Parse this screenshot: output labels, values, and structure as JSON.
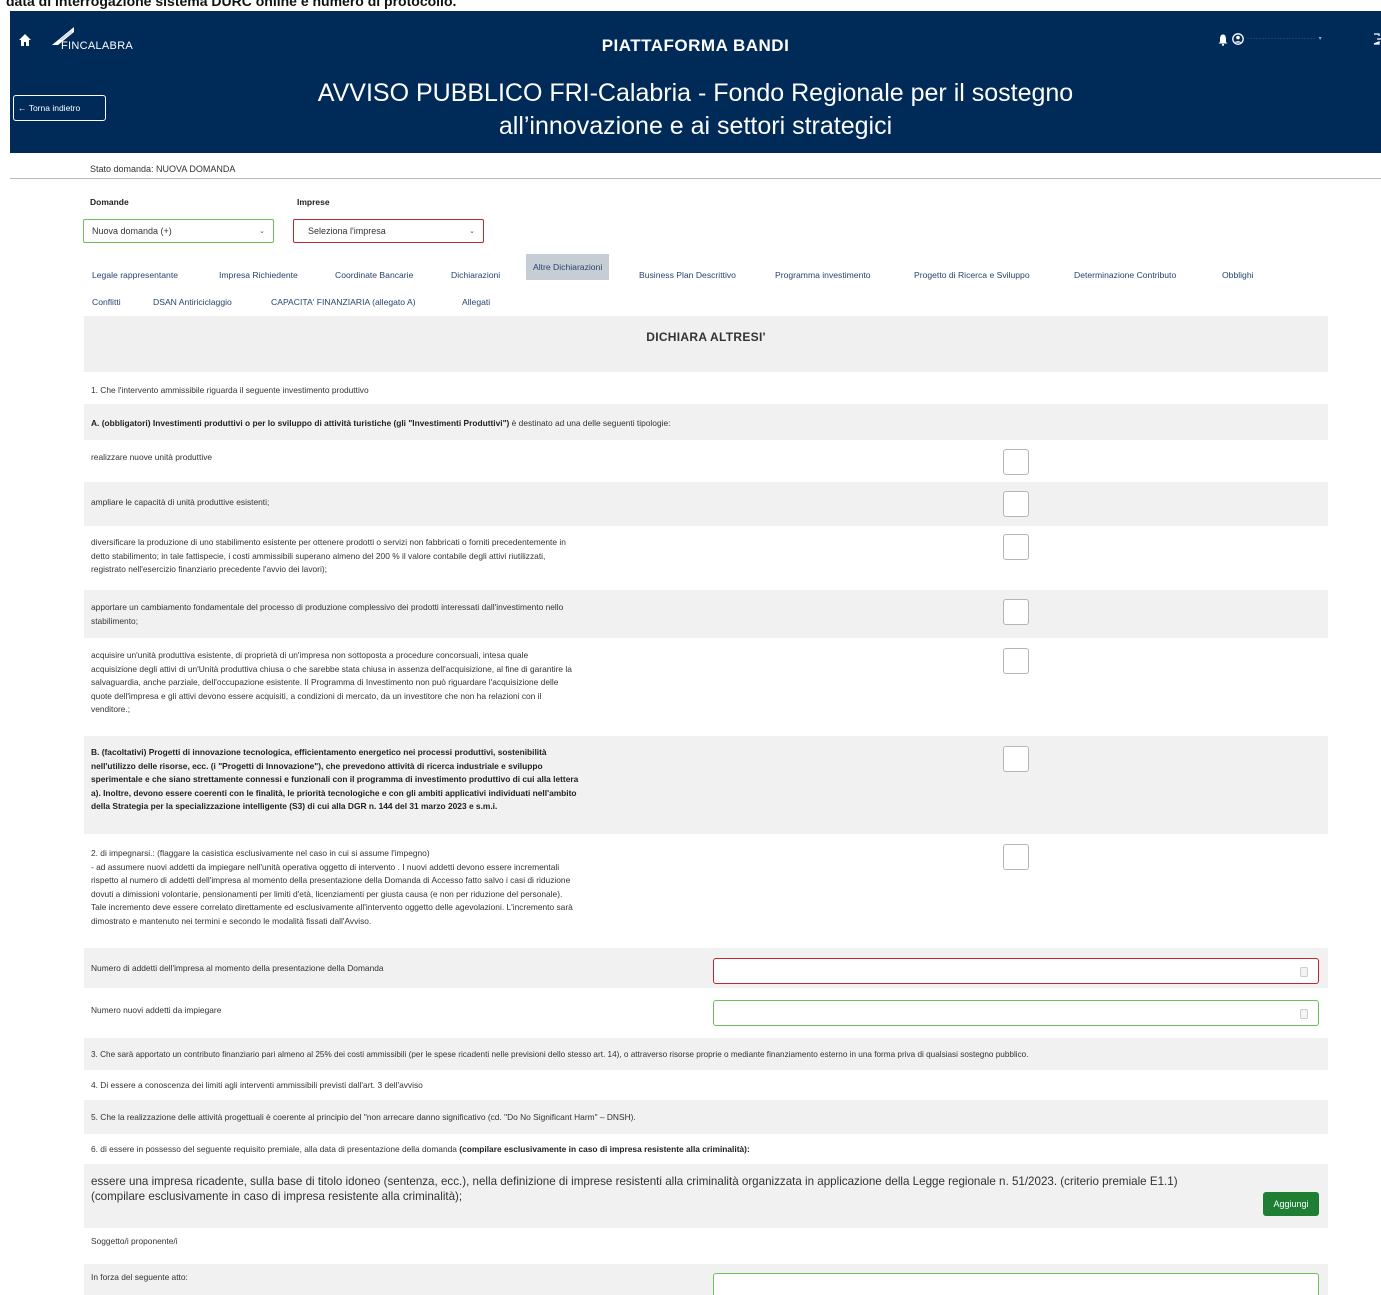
{
  "top_strip": "data di interrogazione sistema DURC online e numero di protocollo.",
  "header": {
    "logo_text": "FINCALABRA",
    "platform_title": "PIATTAFORMA BANDI",
    "title_line1": "AVVISO PUBBLICO FRI-Calabria - Fondo Regionale per il sostegno",
    "title_line2": "all’innovazione e ai settori strategici",
    "back_label": "← Torna indietro",
    "user_name": "······················· ▾"
  },
  "status": {
    "text": "Stato domanda: NUOVA DOMANDA"
  },
  "selects": {
    "domande_label": "Domande",
    "domande_value": "Nuova domanda (+)",
    "imprese_label": "Imprese",
    "imprese_value": "Seleziona l'impresa"
  },
  "tabs_row1": [
    "Legale rappresentante",
    "Impresa Richiedente",
    "Coordinate Bancarie",
    "Dichiarazioni",
    "Altre Dichiarazioni",
    "Business Plan Descrittivo",
    "Programma investimento",
    "Progetto di Ricerca e Sviluppo",
    "Determinazione Contributo",
    "Obblighi"
  ],
  "tabs_row2": [
    "Conflitti",
    "DSAN Antiriciclaggio",
    "CAPACITA' FINANZIARIA (allegato A)",
    "Allegati"
  ],
  "active_tab": "Altre Dichiarazioni",
  "section_title": "DICHIARA ALTRESI'",
  "items": {
    "intro": "1. Che l'intervento ammissibile riguarda il seguente investimento produttivo",
    "a_header_bold": "A. (obbligatori) Investimenti produttivi o per lo sviluppo di attività turistiche (gli \"Investimenti Produttivi\")",
    "a_header_rest": " è destinato ad una delle seguenti tipologie:",
    "a1": "realizzare nuove unità produttive",
    "a2": "ampliare le capacità di unità produttive esistenti;",
    "a3_l1": "diversificare la produzione di uno stabilimento esistente per ottenere prodotti o servizi non fabbricati o forniti precedentemente in",
    "a3_l2": "detto stabilimento; in tale fattispecie, i costi ammissibili superano almeno del 200 % il valore contabile degli attivi riutilizzati,",
    "a3_l3": "registrato nell'esercizio finanziario precedente l'avvio dei lavori);",
    "a4_l1": "apportare un cambiamento fondamentale del processo di produzione complessivo dei prodotti interessati dall'investimento nello",
    "a4_l2": "stabilimento;",
    "a5_l1": "acquisire un'unità produttiva esistente, di proprietà di un'impresa non sottoposta a procedure concorsuali, intesa quale",
    "a5_l2": "acquisizione degli attivi di un'Unità produttiva chiusa o che sarebbe stata chiusa in assenza dell'acquisizione, al fine di garantire la",
    "a5_l3": "salvaguardia, anche parziale, dell'occupazione esistente. Il Programma di Investimento non può riguardare l'acquisizione delle",
    "a5_l4": "quote dell'impresa e gli attivi devono essere acquisiti, a condizioni di mercato, da un investitore che non ha relazioni con il",
    "a5_l5": "venditore.;",
    "b_l1": "B. (facoltativi) Progetti di innovazione tecnologica, efficientamento energetico nei processi produttivi, sostenibilità",
    "b_l2": "nell'utilizzo delle risorse, ecc. (i \"Progetti di Innovazione\"), che prevedono attività di ricerca industriale e sviluppo",
    "b_l3": "sperimentale e che siano strettamente connessi e funzionali con il programma di investimento produttivo di cui alla lettera",
    "b_l4": "a). Inoltre, devono essere coerenti con le finalità, le priorità tecnologiche e con gli ambiti applicativi individuati nell'ambito",
    "b_l5": "della Strategia per la specializzazione intelligente (S3) di cui alla DGR n. 144 del 31 marzo 2023 e s.m.i.",
    "c2_l1": "2. di impegnarsi.: (flaggare la casistica esclusivamente nel caso in cui si assume l'impegno)",
    "c2_l2": "- ad assumere nuovi addetti da impiegare nell'unità operativa oggetto di intervento . I nuovi addetti devono essere incrementali",
    "c2_l3": "rispetto al numero di addetti dell'impresa al momento della presentazione della Domanda di Accesso fatto salvo i casi di riduzione",
    "c2_l4": "dovuti a dimissioni volontarie, pensionamenti per limiti d'età, licenziamenti per giusta causa (e non per riduzione del personale).",
    "c2_l5": "Tale incremento deve essere correlato direttamente ed esclusivamente all'intervento oggetto delle agevolazioni. L'incremento sarà",
    "c2_l6": "dimostrato e mantenuto nei termini e secondo le modalità fissati dall'Avviso.",
    "num_addetti_label": "Numero di addetti dell'impresa al momento della presentazione della Domanda",
    "num_nuovi_label": "Numero nuovi addetti da impiegare",
    "i3": "3. Che sarà apportato un contributo finanziario pari almeno al 25% dei costi ammissibili (per le spese ricadenti nelle previsioni dello stesso art. 14), o attraverso risorse proprie o mediante finanziamento esterno in una forma priva di qualsiasi sostegno pubblico.",
    "i4": "4. Di essere a conoscenza dei limiti agli interventi ammissibili previsti dall'art. 3 dell'avviso",
    "i5": "5. Che la realizzazione delle attività progettuali è coerente al principio del \"non arrecare danno significativo (cd. \"Do No Significant Harm\" – DNSH).",
    "i6_rest": "6. di essere in possesso del seguente requisito premiale, alla data di presentazione della domanda ",
    "i6_bold": "(compilare esclusivamente in caso di impresa resistente alla criminalità):",
    "e1_l1": "essere una impresa ricadente, sulla base di titolo idoneo (sentenza, ecc.), nella definizione di imprese resistenti alla criminalità organizzata in applicazione della Legge regionale n. 51/2023. (criterio premiale E1.1)",
    "e1_l2": "(compilare esclusivamente in caso di impresa resistente alla criminalità);",
    "add_button": "Aggiungi",
    "soggetto": "Soggetto/i proponente/i",
    "in_forza": "In forza del seguente atto:"
  },
  "colors": {
    "header_bg": "#002a57",
    "invalid_border": "#c0272d",
    "valid_border": "#6dbf59",
    "add_button": "#1e7e34",
    "tab_text": "#27446e"
  }
}
